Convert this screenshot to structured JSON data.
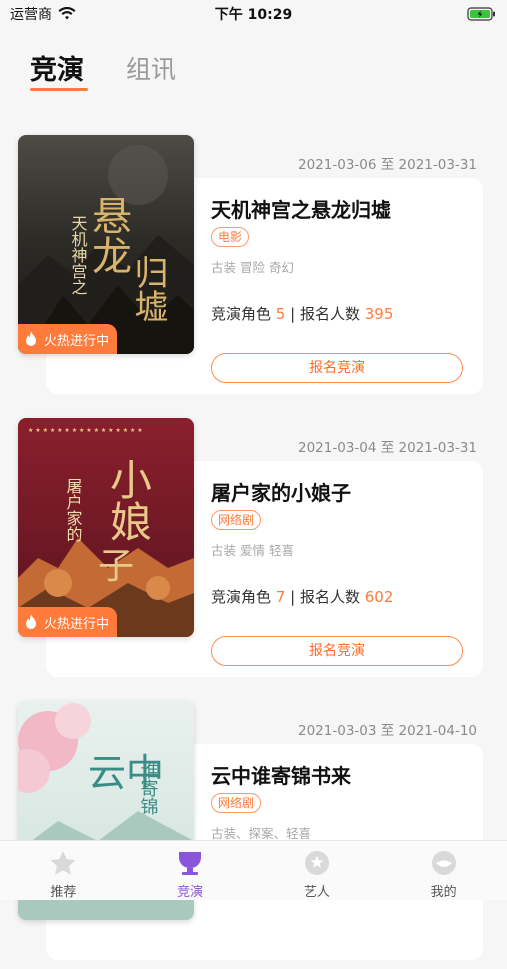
{
  "status_bar": {
    "carrier": "运营商",
    "time": "下午 10:29"
  },
  "tabs": {
    "active": "竞演",
    "inactive": "组讯"
  },
  "cards": [
    {
      "date_range": "2021-03-06 至 2021-03-31",
      "title": "天机神宫之悬龙归墟",
      "genre": "电影",
      "tags": "古装 冒险 奇幻",
      "roles_label": "竞演角色",
      "roles_count": "5",
      "signup_label": "报名人数",
      "signup_count": "395",
      "button": "报名竞演",
      "hot_badge": "火热进行中",
      "poster_text": "天机神宫之悬龙归墟"
    },
    {
      "date_range": "2021-03-04 至 2021-03-31",
      "title": "屠户家的小娘子",
      "genre": "网络剧",
      "tags": "古装 爱情 轻喜",
      "roles_label": "竞演角色",
      "roles_count": "7",
      "signup_label": "报名人数",
      "signup_count": "602",
      "button": "报名竞演",
      "hot_badge": "火热进行中",
      "poster_text": "屠户家的小娘子"
    },
    {
      "date_range": "2021-03-03 至 2021-04-10",
      "title": "云中谁寄锦书来",
      "genre": "网络剧",
      "tags": "古装、探案、轻喜",
      "poster_text": "云中谁寄锦书来"
    }
  ],
  "tabbar": [
    {
      "label": "推荐",
      "icon": "star-icon"
    },
    {
      "label": "竞演",
      "icon": "trophy-icon"
    },
    {
      "label": "艺人",
      "icon": "artist-icon"
    },
    {
      "label": "我的",
      "icon": "profile-icon"
    }
  ],
  "colors": {
    "accent": "#ff7b3b",
    "active_tab": "#8a55d8"
  }
}
